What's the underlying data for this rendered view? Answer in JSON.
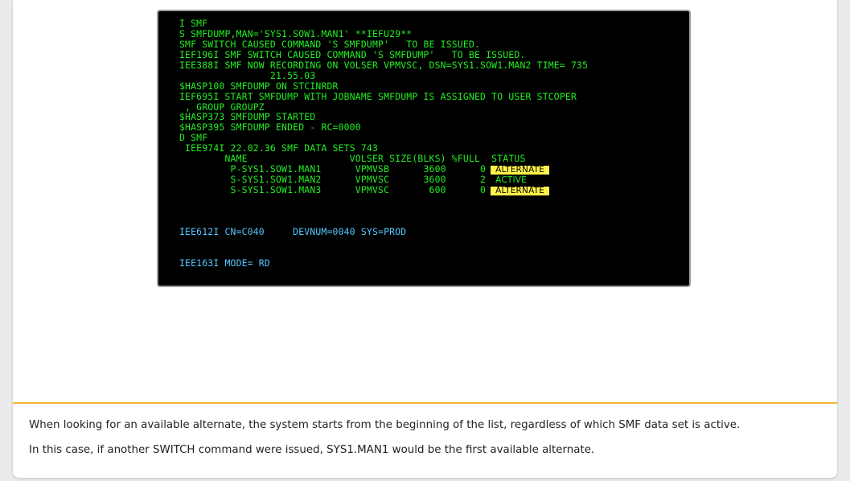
{
  "terminal": {
    "lines": [
      "I SMF",
      "S SMFDUMP,MAN='SYS1.SOW1.MAN1' **IEFU29**",
      "SMF SWITCH CAUSED COMMAND 'S SMFDUMP'   TO BE ISSUED.",
      "IEF196I SMF SWITCH CAUSED COMMAND 'S SMFDUMP'   TO BE ISSUED.",
      "IEE388I SMF NOW RECORDING ON VOLSER VPMVSC, DSN=SYS1.SOW1.MAN2 TIME= 735",
      "                21.55.03",
      "$HASP100 SMFDUMP ON STCINRDR",
      "IEF695I START SMFDUMP WITH JOBNAME SMFDUMP IS ASSIGNED TO USER STCOPER",
      " , GROUP GROUPZ",
      "$HASP373 SMFDUMP STARTED",
      "$HASP395 SMFDUMP ENDED - RC=0000",
      "D SMF",
      " IEE974I 22.02.36 SMF DATA SETS 743",
      "        NAME                  VOLSER SIZE(BLKS) %FULL  STATUS"
    ],
    "datasets": [
      {
        "text": "         P-SYS1.SOW1.MAN1      VPMVSB      3600      0",
        "status": "ALTERNATE"
      },
      {
        "text": "         S-SYS1.SOW1.MAN2      VPMVSC      3600      2",
        "status": "ACTIVE"
      },
      {
        "text": "         S-SYS1.SOW1.MAN3      VPMVSC       600      0",
        "status": "ALTERNATE"
      }
    ],
    "status_line": "IEE612I CN=C040     DEVNUM=0040 SYS=PROD",
    "mode_line": "IEE163I MODE= RD"
  },
  "notes": [
    "When looking for an available alternate, the system starts from the beginning of the list, regardless of which SMF data set is active.",
    "In this case, if another SWITCH command were issued, SYS1.MAN1 would be the first available alternate."
  ],
  "colors": {
    "terminal_bg": "#000000",
    "terminal_text": "#22ee22",
    "terminal_info": "#55c8ff",
    "highlight": "#fff34a",
    "divider": "#f0b73a"
  }
}
